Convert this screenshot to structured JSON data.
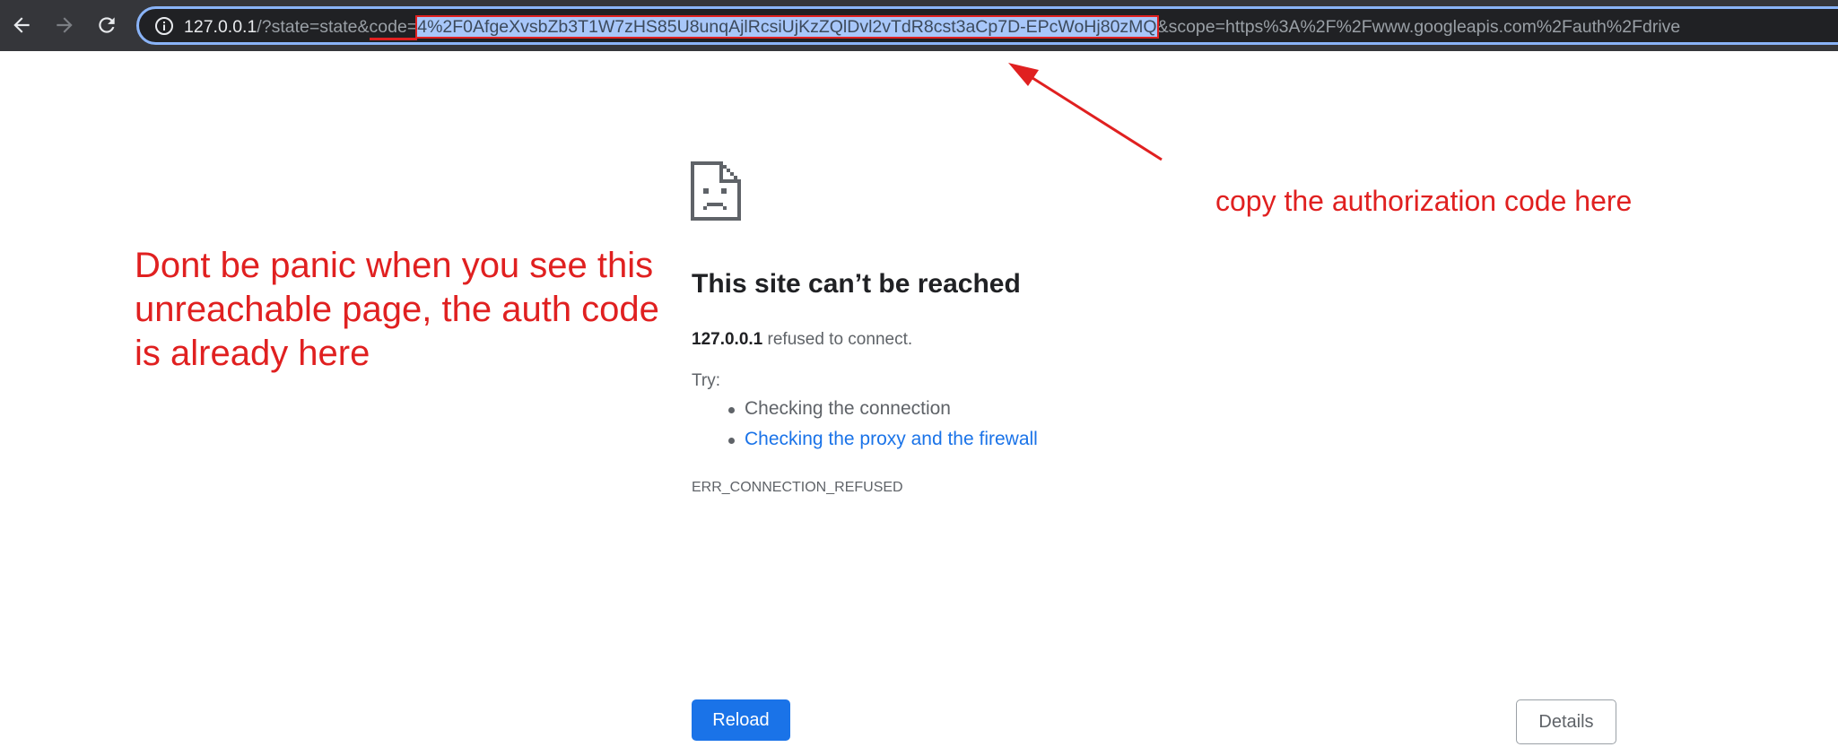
{
  "browser": {
    "url": {
      "host": "127.0.0.1",
      "prefix": "/?state=state&",
      "code_key": "code=",
      "code_value": "4%2F0AfgeXvsbZb3T1W7zHS85U8unqAjlRcsiUjKzZQlDvl2vTdR8cst3aCp7D-EPcWoHj80zMQ",
      "suffix": "&scope=https%3A%2F%2Fwww.googleapis.com%2Fauth%2Fdrive"
    },
    "icons": {
      "back": "arrow-left-icon",
      "forward": "arrow-right-icon",
      "reload": "reload-icon",
      "info": "info-icon"
    }
  },
  "error_page": {
    "icon": "sad-page-icon",
    "title": "This site can’t be reached",
    "host": "127.0.0.1",
    "message": " refused to connect.",
    "try_label": "Try:",
    "suggestions": [
      "Checking the connection",
      "Checking the proxy and the firewall"
    ],
    "error_code": "ERR_CONNECTION_REFUSED",
    "reload_label": "Reload",
    "details_label": "Details"
  },
  "annotations": {
    "left_note": "Dont be panic when you see this unreachable page, the auth code is already here",
    "right_note": "copy the authorization code here",
    "color": "#e02020"
  },
  "colors": {
    "toolbar": "#35363a",
    "omnibox": "#202124",
    "omnibox_focus": "#8ab4f8",
    "selection": "#a8c7fa",
    "link": "#1a73e8",
    "button": "#1a73e8"
  }
}
